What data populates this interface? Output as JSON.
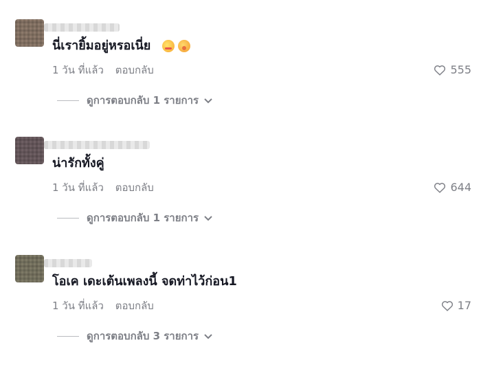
{
  "comments": [
    {
      "text": "นี่เรายิ้มอยู่หรอเนี่ย",
      "emojis": [
        "relieved-face-emoji",
        "face-with-hand-over-mouth-emoji"
      ],
      "time": "1 วัน ที่แล้ว",
      "reply_label": "ตอบกลับ",
      "likes": "555",
      "view_replies": "ดูการตอบกลับ 1 รายการ"
    },
    {
      "text": "น่ารักทั้งคู่",
      "emojis": [],
      "time": "1 วัน ที่แล้ว",
      "reply_label": "ตอบกลับ",
      "likes": "644",
      "view_replies": "ดูการตอบกลับ 1 รายการ"
    },
    {
      "text": "โอเค เดะเต้นเพลงนี้ จดท่าไว้ก่อน1",
      "emojis": [],
      "time": "1 วัน ที่แล้ว",
      "reply_label": "ตอบกลับ",
      "likes": "17",
      "view_replies": "ดูการตอบกลับ 3 รายการ"
    }
  ],
  "icons": {
    "like": "heart-outline-icon",
    "expand": "chevron-down-icon"
  },
  "colors": {
    "text": "#161823",
    "secondary": "#7d7f86",
    "background": "#ffffff"
  }
}
